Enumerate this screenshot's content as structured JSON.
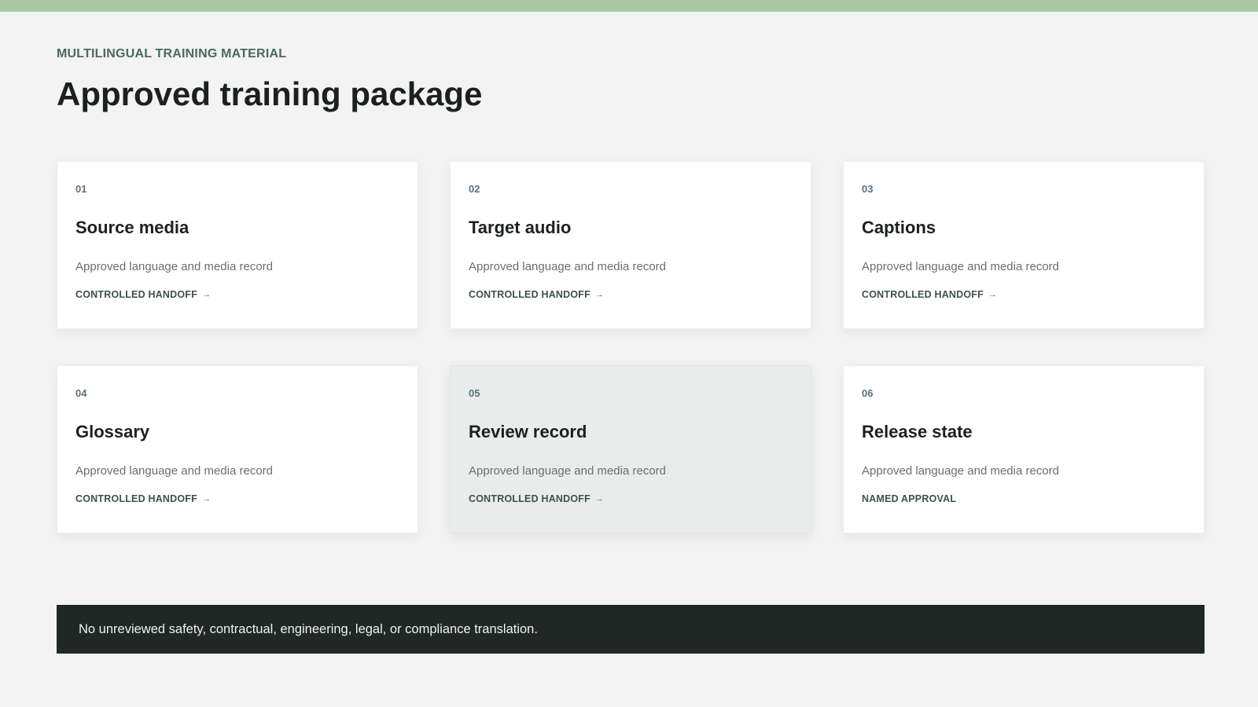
{
  "colors": {
    "accent_bar": "#a9c9a2",
    "background": "#f2f3f2",
    "card": "#ffffff",
    "card_highlight": "#e9ecea",
    "notice_background": "#202826"
  },
  "header": {
    "eyebrow": "MULTILINGUAL TRAINING MATERIAL",
    "title": "Approved training package"
  },
  "cards": [
    {
      "number": "01",
      "title": "Source media",
      "description": "Approved language and media record",
      "action": "CONTROLLED HANDOFF",
      "action_icon": "arrow-right-icon"
    },
    {
      "number": "02",
      "title": "Target audio",
      "description": "Approved language and media record",
      "action": "CONTROLLED HANDOFF",
      "action_icon": "arrow-right-icon"
    },
    {
      "number": "03",
      "title": "Captions",
      "description": "Approved language and media record",
      "action": "CONTROLLED HANDOFF",
      "action_icon": "arrow-right-icon"
    },
    {
      "number": "04",
      "title": "Glossary",
      "description": "Approved language and media record",
      "action": "CONTROLLED HANDOFF",
      "action_icon": "arrow-right-icon"
    },
    {
      "number": "05",
      "title": "Review record",
      "description": "Approved language and media record",
      "action": "CONTROLLED HANDOFF",
      "action_icon": "arrow-right-icon",
      "highlighted": true
    },
    {
      "number": "06",
      "title": "Release state",
      "description": "Approved language and media record",
      "action": "NAMED APPROVAL"
    }
  ],
  "notice": {
    "text": "No unreviewed safety, contractual, engineering, legal, or compliance translation."
  }
}
